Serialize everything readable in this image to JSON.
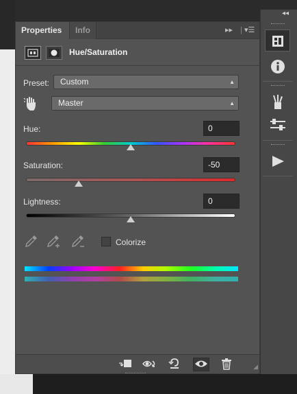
{
  "tabs": {
    "properties": "Properties",
    "info": "Info"
  },
  "panel": {
    "title": "Hue/Saturation"
  },
  "preset": {
    "label": "Preset:",
    "value": "Custom"
  },
  "channel": {
    "value": "Master"
  },
  "hue": {
    "label": "Hue:",
    "value": "0",
    "level": 0
  },
  "saturation": {
    "label": "Saturation:",
    "value": "-50",
    "level": -50
  },
  "lightness": {
    "label": "Lightness:",
    "value": "0",
    "level": 0
  },
  "colorize": {
    "label": "Colorize",
    "checked": false
  },
  "icons": {
    "tab_menu": "double-chevron-right-icon",
    "panel_menu": "panel-menu-icon",
    "adjustment": "adjustment-layer-icon",
    "mask": "mask-icon",
    "target": "targeted-adjustment-hand-icon",
    "eyedroppers": [
      "eyedropper-icon",
      "eyedropper-plus-icon",
      "eyedropper-minus-icon"
    ],
    "footer": [
      "clip-to-layer-icon",
      "view-previous-state-icon",
      "reset-icon",
      "visibility-eye-icon",
      "delete-trash-icon"
    ],
    "dock": [
      "properties-panel-icon",
      "info-icon",
      "brushes-icon",
      "adjustments-sliders-icon",
      "play-actions-icon"
    ]
  },
  "colors": {
    "panel": "#535353",
    "tab_bar": "#434343",
    "field": "#2b2b2b",
    "dock": "#474747"
  }
}
